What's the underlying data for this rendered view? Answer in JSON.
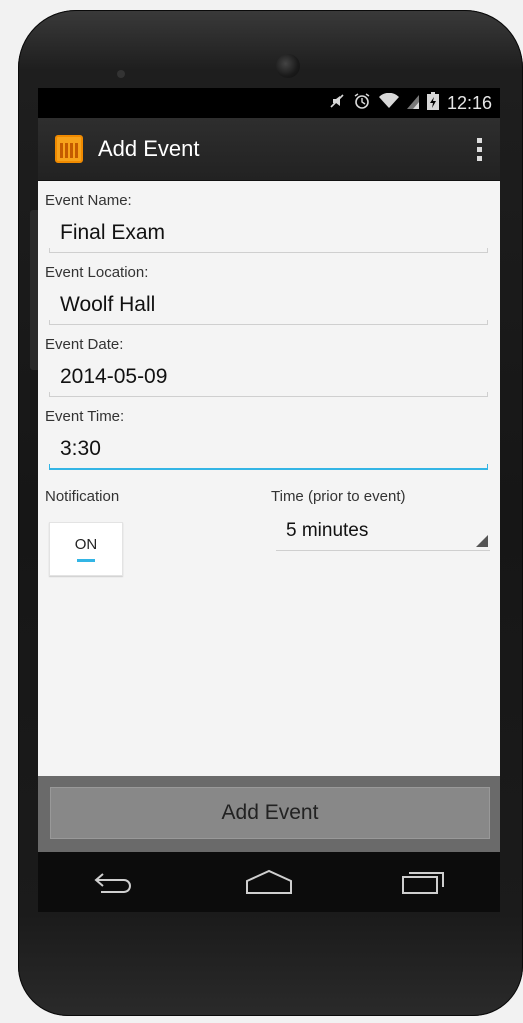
{
  "status_bar": {
    "icons": [
      "mute-icon",
      "alarm-icon",
      "wifi-icon",
      "signal-icon",
      "battery-icon"
    ],
    "time": "12:16"
  },
  "action_bar": {
    "app_icon": "calendar-icon",
    "title": "Add Event",
    "overflow_icon": "overflow-menu-icon"
  },
  "form": {
    "event_name_label": "Event Name:",
    "event_name_value": "Final Exam",
    "event_location_label": "Event Location:",
    "event_location_value": "Woolf Hall",
    "event_date_label": "Event Date:",
    "event_date_value": "2014-05-09",
    "event_time_label": "Event Time:",
    "event_time_value": "3:30",
    "notification_label": "Notification",
    "notification_toggle": "ON",
    "prior_label": "Time (prior to event)",
    "prior_value": "5 minutes"
  },
  "bottom": {
    "add_button": "Add Event"
  },
  "nav": [
    "back-icon",
    "home-icon",
    "recent-apps-icon"
  ],
  "colors": {
    "accent": "#33b5e5",
    "app_icon": "#f7a21b"
  }
}
